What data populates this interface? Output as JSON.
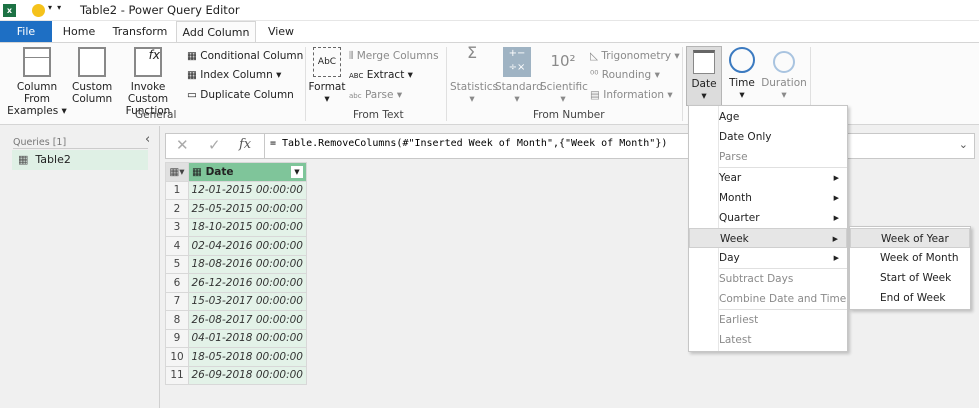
{
  "window": {
    "title": "Table2 - Power Query Editor"
  },
  "tabs": [
    {
      "label": "File"
    },
    {
      "label": "Home"
    },
    {
      "label": "Transform"
    },
    {
      "label": "Add Column",
      "active": true
    },
    {
      "label": "View"
    }
  ],
  "ribbon": {
    "general": {
      "label": "General",
      "column_from_examples": "Column From Examples",
      "custom_column": "Custom Column",
      "invoke_custom_function": "Invoke Custom Function",
      "conditional_column": "Conditional Column",
      "index_column": "Index Column",
      "duplicate_column": "Duplicate Column"
    },
    "from_text": {
      "label": "From Text",
      "format": "Format",
      "merge_columns": "Merge Columns",
      "extract": "Extract",
      "parse": "Parse"
    },
    "from_number": {
      "label": "From Number",
      "statistics": "Statistics",
      "standard": "Standard",
      "scientific": "Scientific",
      "trigonometry": "Trigonometry",
      "rounding": "Rounding",
      "information": "Information"
    },
    "from_date": {
      "date": "Date",
      "time": "Time",
      "duration": "Duration"
    }
  },
  "queries": {
    "header": "Queries [1]",
    "items": [
      "Table2"
    ]
  },
  "formula": {
    "text": "= Table.RemoveColumns(#\"Inserted Week of Month\",{\"Week of Month\"})",
    "fx": "fx"
  },
  "table": {
    "column": "Date",
    "rows": [
      "12-01-2015 00:00:00",
      "25-05-2015 00:00:00",
      "18-10-2015 00:00:00",
      "02-04-2016 00:00:00",
      "18-08-2016 00:00:00",
      "26-12-2016 00:00:00",
      "15-03-2017 00:00:00",
      "26-08-2017 00:00:00",
      "04-01-2018 00:00:00",
      "18-05-2018 00:00:00",
      "26-09-2018 00:00:00"
    ]
  },
  "date_menu": {
    "items": [
      "Age",
      "Date Only",
      "Parse",
      "Year",
      "Month",
      "Quarter",
      "Week",
      "Day",
      "Subtract Days",
      "Combine Date and Time",
      "Earliest",
      "Latest"
    ]
  },
  "week_submenu": {
    "items": [
      "Week of Year",
      "Week of Month",
      "Start of Week",
      "End of Week"
    ]
  },
  "colors": {
    "file_tab": "#1e6fc4",
    "selection_green": "#dff0e5",
    "excel_green": "#1d7244"
  }
}
